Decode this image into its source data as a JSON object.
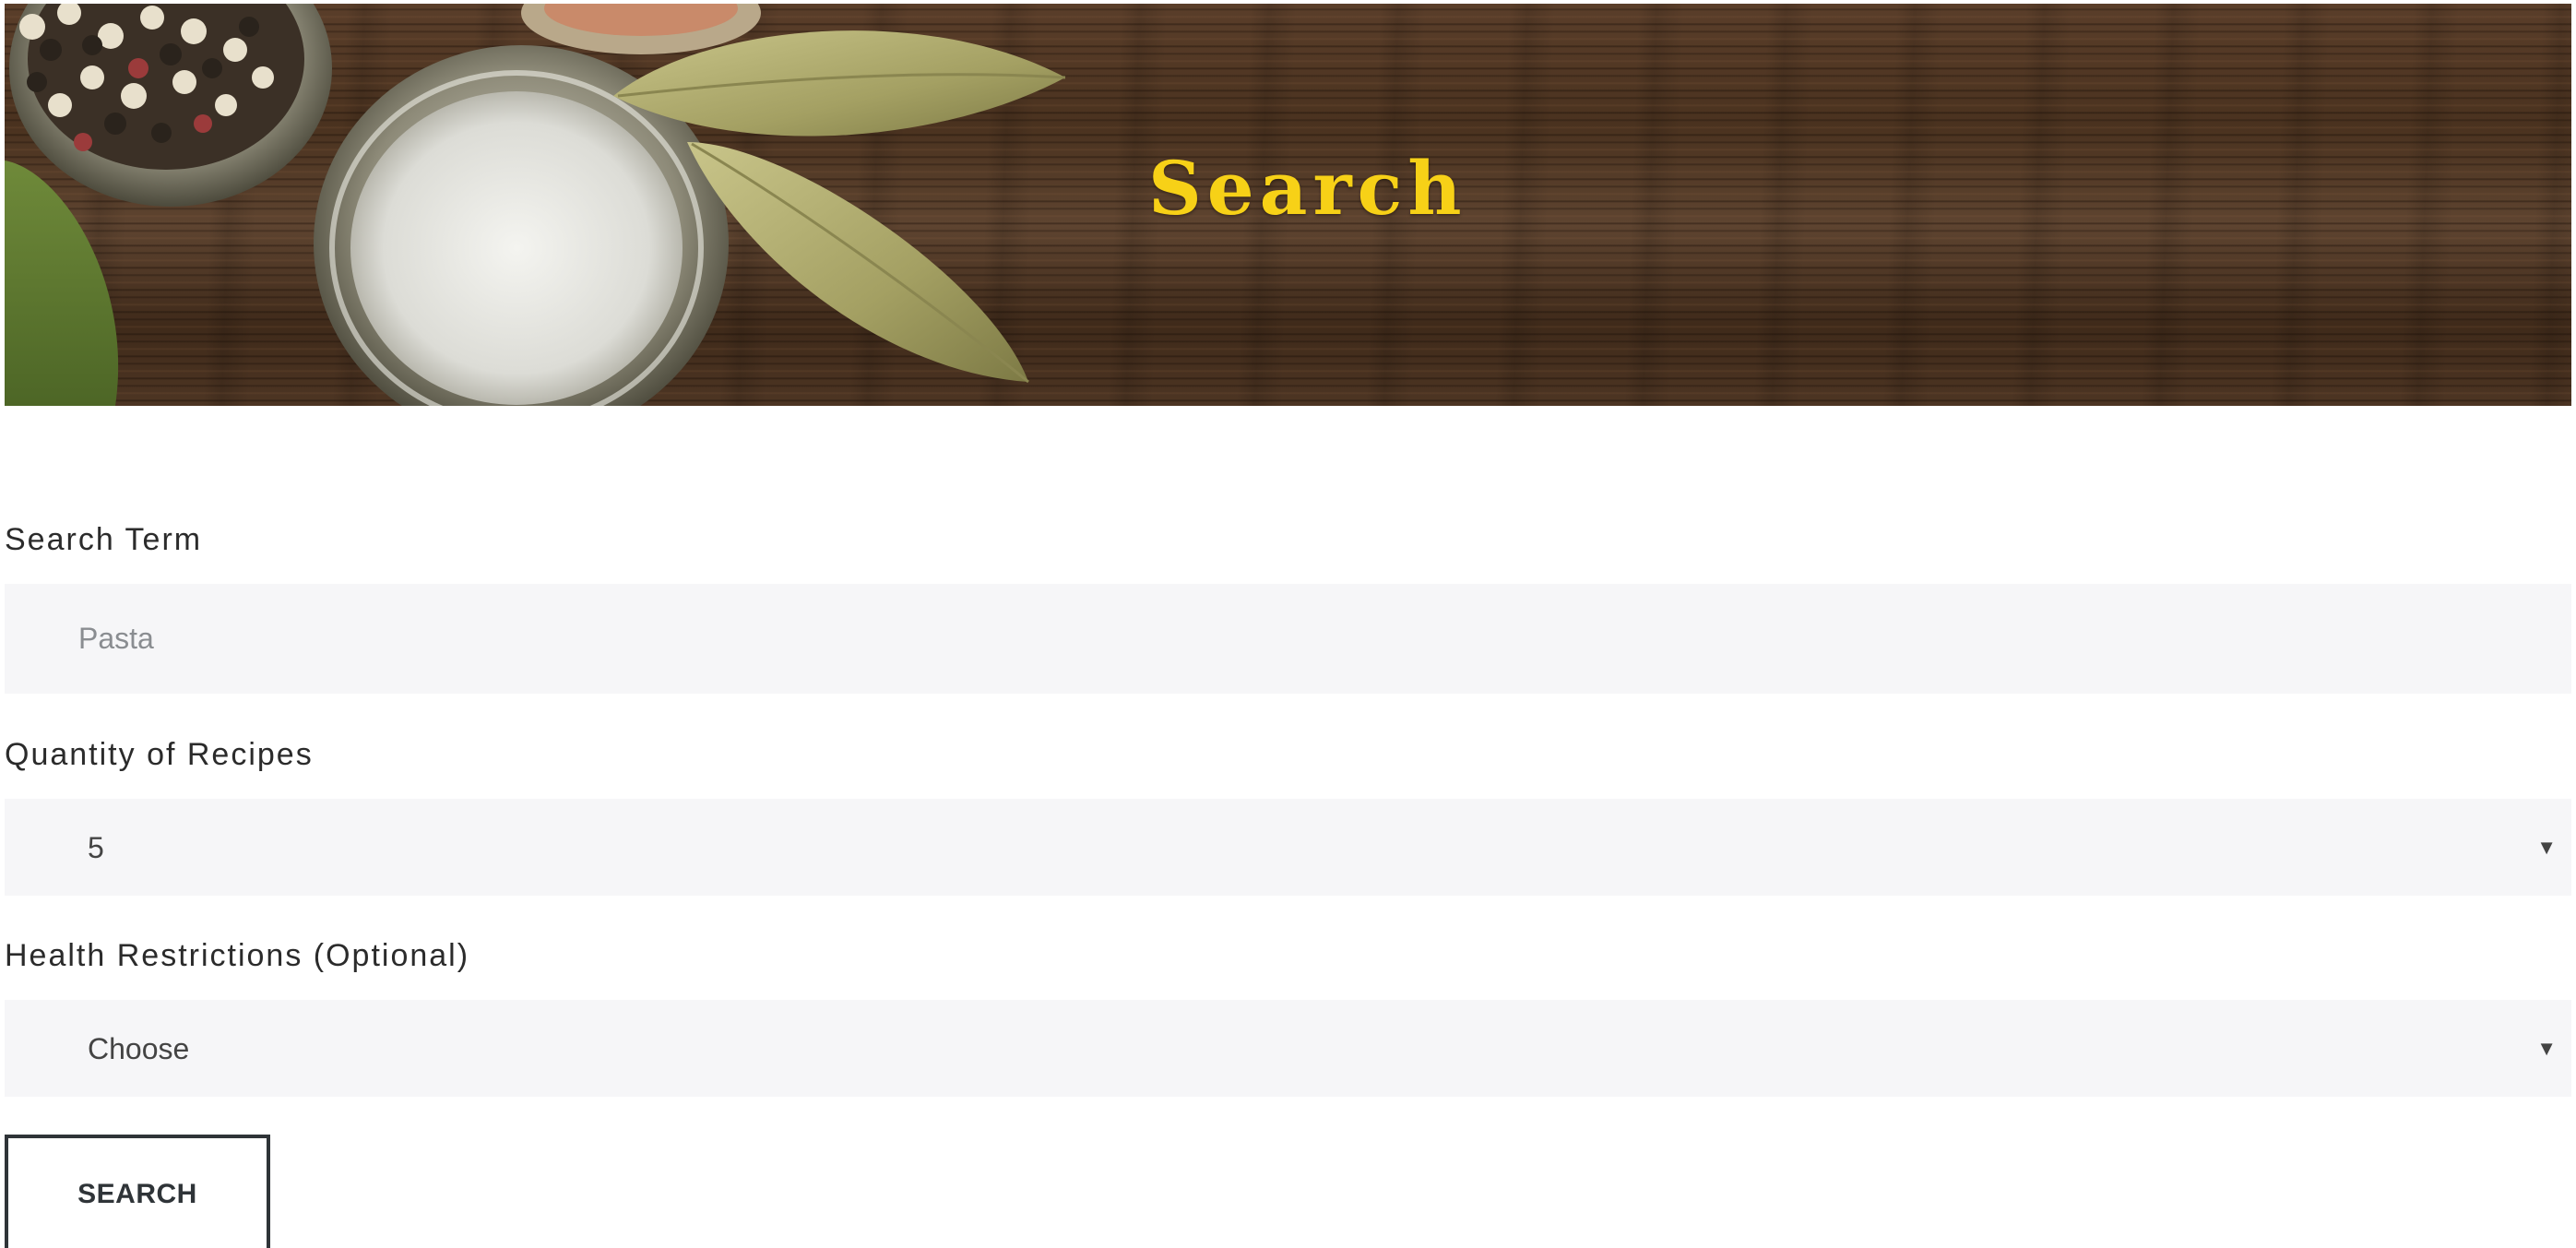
{
  "header": {
    "title": "Search"
  },
  "form": {
    "search_term": {
      "label": "Search Term",
      "value": "",
      "placeholder": "Pasta"
    },
    "quantity": {
      "label": "Quantity of Recipes",
      "selected": "5"
    },
    "health": {
      "label": "Health Restrictions (Optional)",
      "selected": "Choose"
    },
    "submit_label": "SEARCH"
  },
  "icons": {
    "dropdown": "chevron-down-icon"
  },
  "colors": {
    "title": "#f7d117",
    "input_background": "#f6f6f8",
    "button_border": "#2f3438"
  }
}
